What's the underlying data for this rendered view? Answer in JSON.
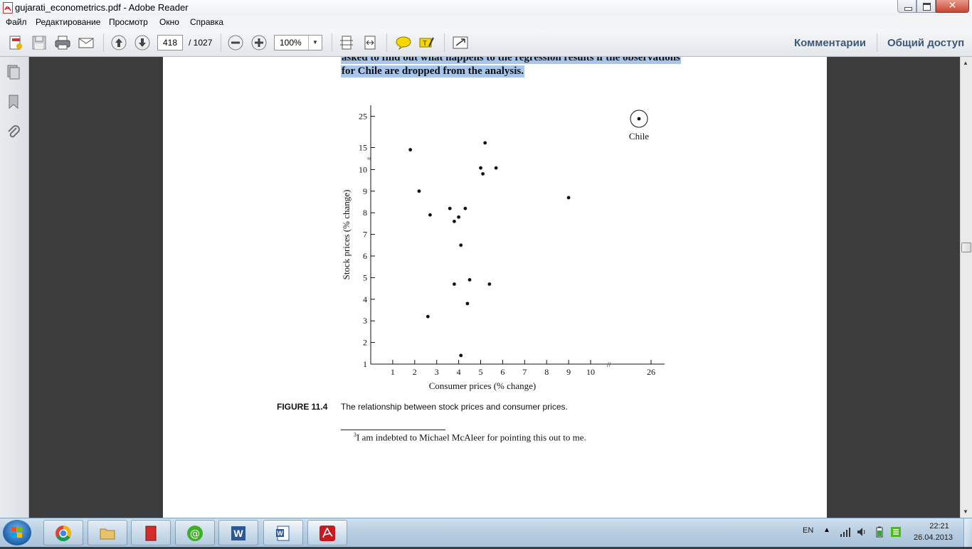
{
  "window": {
    "title": "gujarati_econometrics.pdf - Adobe Reader"
  },
  "menu": {
    "items": [
      "Файл",
      "Редактирование",
      "Просмотр",
      "Окно",
      "Справка"
    ]
  },
  "toolbar": {
    "page_current": "418",
    "page_total": "/ 1027",
    "zoom": "100%",
    "comments_label": "Комментарии",
    "share_label": "Общий доступ"
  },
  "document": {
    "highlight_line1": "asked to find out what happens to the regression results if the observations",
    "highlight_line2": "for Chile are dropped from the analysis.",
    "figure_label": "FIGURE 11.4",
    "figure_caption": "The relationship between stock prices and consumer prices.",
    "footnote_marker": "3",
    "footnote": "I am indebted to Michael McAleer for pointing this out to me."
  },
  "chart_data": {
    "type": "scatter",
    "title": "",
    "xlabel": "Consumer prices (% change)",
    "ylabel": "Stock prices (% change)",
    "x_ticks": [
      "1",
      "2",
      "3",
      "4",
      "5",
      "6",
      "7",
      "8",
      "9",
      "10",
      "26"
    ],
    "y_ticks": [
      "1",
      "2",
      "3",
      "4",
      "5",
      "6",
      "7",
      "8",
      "9",
      "10",
      "15",
      "25"
    ],
    "annotation": "Chile",
    "axis_breaks": [
      "x between 10 and 26",
      "y between 10 and 15"
    ],
    "points": [
      {
        "x": 1.8,
        "y": 14.5
      },
      {
        "x": 2.2,
        "y": 9.0
      },
      {
        "x": 2.7,
        "y": 7.9
      },
      {
        "x": 2.6,
        "y": 3.2
      },
      {
        "x": 3.6,
        "y": 8.2
      },
      {
        "x": 3.8,
        "y": 7.6
      },
      {
        "x": 4.0,
        "y": 7.8
      },
      {
        "x": 4.3,
        "y": 8.2
      },
      {
        "x": 4.1,
        "y": 6.5
      },
      {
        "x": 3.8,
        "y": 4.7
      },
      {
        "x": 4.5,
        "y": 4.9
      },
      {
        "x": 4.4,
        "y": 3.8
      },
      {
        "x": 4.1,
        "y": 1.4
      },
      {
        "x": 5.0,
        "y": 10.3
      },
      {
        "x": 5.1,
        "y": 9.8
      },
      {
        "x": 5.2,
        "y": 16.5
      },
      {
        "x": 5.7,
        "y": 10.3
      },
      {
        "x": 5.4,
        "y": 4.7
      },
      {
        "x": 9.0,
        "y": 8.7
      },
      {
        "x": 26.0,
        "y": 25.0,
        "label": "Chile"
      }
    ]
  },
  "taskbar": {
    "lang": "EN",
    "time": "22:21",
    "date": "26.04.2013"
  }
}
